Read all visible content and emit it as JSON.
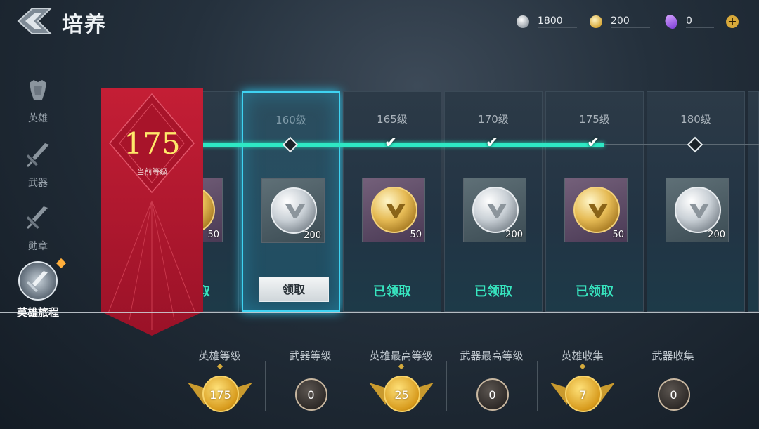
{
  "header": {
    "title": "培养",
    "currencies": [
      {
        "icon": "silver-coin-icon",
        "value": "1800"
      },
      {
        "icon": "gold-coin-icon",
        "value": "200"
      },
      {
        "icon": "purple-gem-icon",
        "value": "0"
      }
    ],
    "plus": "+"
  },
  "sidebar": {
    "items": [
      {
        "label": "英雄",
        "icon": "armor-icon"
      },
      {
        "label": "武器",
        "icon": "sword-icon"
      },
      {
        "label": "勋章",
        "icon": "medal-sword-icon"
      },
      {
        "label": "英雄旅程",
        "icon": "journey-icon",
        "active": true
      }
    ]
  },
  "banner": {
    "level": "175",
    "label": "当前等级"
  },
  "cards": [
    {
      "level": "",
      "coin": "gold",
      "qty": "50",
      "status": "取"
    },
    {
      "level": "160级",
      "coin": "silver",
      "qty": "200",
      "status": "领取",
      "current": true
    },
    {
      "level": "165级",
      "coin": "gold",
      "qty": "50",
      "status": "已领取"
    },
    {
      "level": "170级",
      "coin": "silver",
      "qty": "200",
      "status": "已领取"
    },
    {
      "level": "175级",
      "coin": "gold",
      "qty": "50",
      "status": "已领取"
    },
    {
      "level": "180级",
      "coin": "silver",
      "qty": "200",
      "status": ""
    }
  ],
  "track": {
    "nodes": [
      "diamond",
      "check",
      "check",
      "check",
      "diamond"
    ]
  },
  "stats": [
    {
      "label": "英雄等级",
      "value": "175",
      "style": "gold",
      "dot": true
    },
    {
      "label": "武器等级",
      "value": "0",
      "style": "plain",
      "dot": false
    },
    {
      "label": "英雄最高等级",
      "value": "25",
      "style": "gold",
      "dot": true
    },
    {
      "label": "武器最高等级",
      "value": "0",
      "style": "plain",
      "dot": false
    },
    {
      "label": "英雄收集",
      "value": "7",
      "style": "gold",
      "dot": true
    },
    {
      "label": "武器收集",
      "value": "0",
      "style": "plain",
      "dot": false
    }
  ],
  "colors": {
    "accent": "#2ee8c4",
    "banner_red": "#b0182c",
    "level_yellow": "#ffe76a",
    "claimed_green": "#37e5bf",
    "current_glow": "#3fd3f2"
  }
}
